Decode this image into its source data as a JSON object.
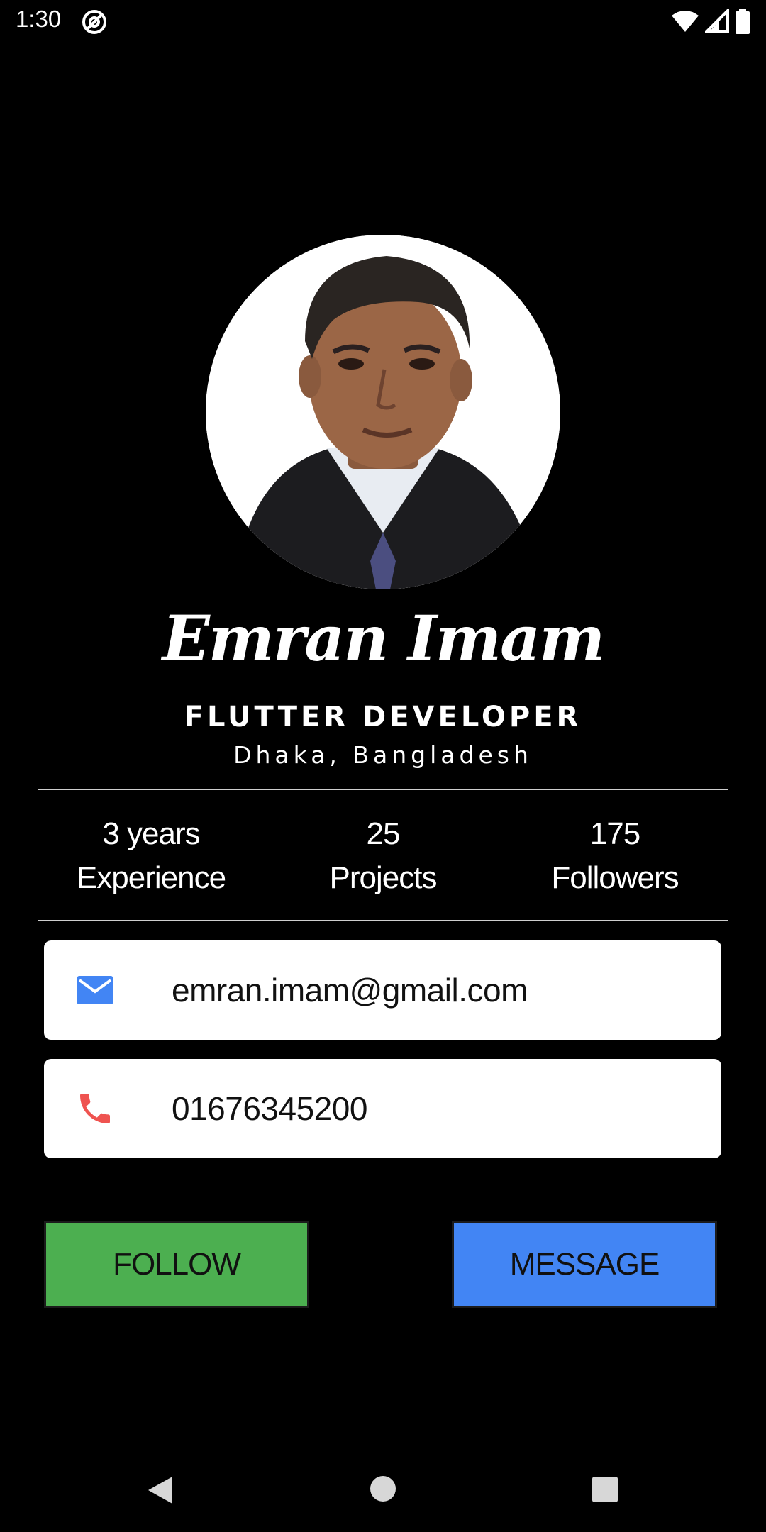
{
  "status_bar": {
    "time": "1:30",
    "app_icon": "at-sign-icon",
    "icons": [
      "wifi-icon",
      "signal-icon",
      "battery-icon"
    ]
  },
  "profile": {
    "name": "Emran Imam",
    "role": "FLUTTER DEVELOPER",
    "location": "Dhaka, Bangladesh"
  },
  "stats": [
    {
      "value": "3 years",
      "label": "Experience"
    },
    {
      "value": "25",
      "label": "Projects"
    },
    {
      "value": "175",
      "label": "Followers"
    }
  ],
  "contacts": {
    "email": {
      "icon": "mail-icon",
      "value": "emran.imam@gmail.com",
      "icon_color": "#4285f4"
    },
    "phone": {
      "icon": "phone-icon",
      "value": "01676345200",
      "icon_color": "#ef5350"
    }
  },
  "buttons": {
    "follow": {
      "label": "FOLLOW",
      "color": "#4caf50"
    },
    "message": {
      "label": "MESSAGE",
      "color": "#4285f4"
    }
  },
  "nav": [
    "back-icon",
    "home-icon",
    "recents-icon"
  ]
}
